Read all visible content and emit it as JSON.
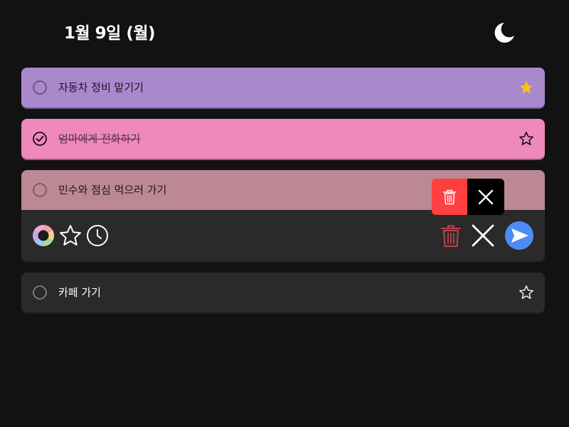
{
  "header": {
    "date": "1월 9일 (월)",
    "theme_icon": "moon-icon"
  },
  "todos": [
    {
      "text": "자동차 정비 맡기기",
      "completed": false,
      "starred": true,
      "color": "#aa88cc"
    },
    {
      "text": "엄마에게 전화하기",
      "completed": true,
      "starred": false,
      "color": "#ef88bb"
    },
    {
      "text": "민수와 점심 먹으러 가기",
      "completed": false,
      "starred": false,
      "color": "#bb8893",
      "editing": true
    },
    {
      "text": "카페 가기",
      "completed": false,
      "starred": false,
      "color": "#2a2a2a"
    }
  ],
  "editor_toolbar": {
    "left_icons": [
      "color-palette-icon",
      "star-icon",
      "clock-icon"
    ],
    "right_icons": [
      "trash-icon",
      "close-icon",
      "send-icon"
    ]
  },
  "swipe_actions": {
    "icons": [
      "trash-icon",
      "close-icon"
    ]
  },
  "colors": {
    "background": "#121212",
    "star_active": "#f5c518",
    "delete": "#ff4040",
    "send": "#4d8cf5",
    "trash_outline": "#c0424a"
  }
}
